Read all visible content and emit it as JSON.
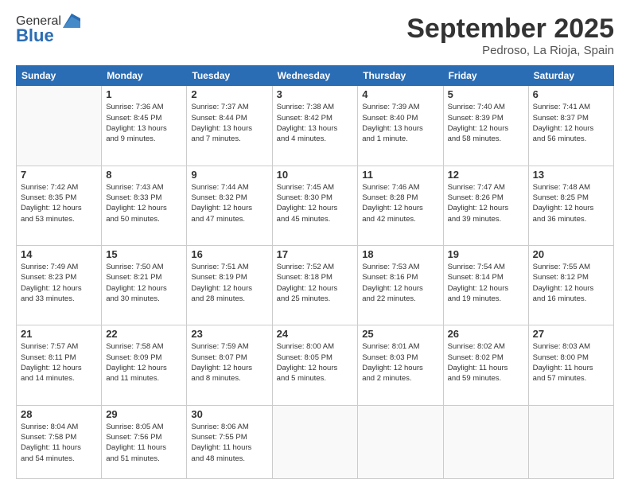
{
  "header": {
    "logo_line1": "General",
    "logo_line2": "Blue",
    "month": "September 2025",
    "location": "Pedroso, La Rioja, Spain"
  },
  "weekdays": [
    "Sunday",
    "Monday",
    "Tuesday",
    "Wednesday",
    "Thursday",
    "Friday",
    "Saturday"
  ],
  "weeks": [
    [
      {
        "day": "",
        "info": ""
      },
      {
        "day": "1",
        "info": "Sunrise: 7:36 AM\nSunset: 8:45 PM\nDaylight: 13 hours\nand 9 minutes."
      },
      {
        "day": "2",
        "info": "Sunrise: 7:37 AM\nSunset: 8:44 PM\nDaylight: 13 hours\nand 7 minutes."
      },
      {
        "day": "3",
        "info": "Sunrise: 7:38 AM\nSunset: 8:42 PM\nDaylight: 13 hours\nand 4 minutes."
      },
      {
        "day": "4",
        "info": "Sunrise: 7:39 AM\nSunset: 8:40 PM\nDaylight: 13 hours\nand 1 minute."
      },
      {
        "day": "5",
        "info": "Sunrise: 7:40 AM\nSunset: 8:39 PM\nDaylight: 12 hours\nand 58 minutes."
      },
      {
        "day": "6",
        "info": "Sunrise: 7:41 AM\nSunset: 8:37 PM\nDaylight: 12 hours\nand 56 minutes."
      }
    ],
    [
      {
        "day": "7",
        "info": "Sunrise: 7:42 AM\nSunset: 8:35 PM\nDaylight: 12 hours\nand 53 minutes."
      },
      {
        "day": "8",
        "info": "Sunrise: 7:43 AM\nSunset: 8:33 PM\nDaylight: 12 hours\nand 50 minutes."
      },
      {
        "day": "9",
        "info": "Sunrise: 7:44 AM\nSunset: 8:32 PM\nDaylight: 12 hours\nand 47 minutes."
      },
      {
        "day": "10",
        "info": "Sunrise: 7:45 AM\nSunset: 8:30 PM\nDaylight: 12 hours\nand 45 minutes."
      },
      {
        "day": "11",
        "info": "Sunrise: 7:46 AM\nSunset: 8:28 PM\nDaylight: 12 hours\nand 42 minutes."
      },
      {
        "day": "12",
        "info": "Sunrise: 7:47 AM\nSunset: 8:26 PM\nDaylight: 12 hours\nand 39 minutes."
      },
      {
        "day": "13",
        "info": "Sunrise: 7:48 AM\nSunset: 8:25 PM\nDaylight: 12 hours\nand 36 minutes."
      }
    ],
    [
      {
        "day": "14",
        "info": "Sunrise: 7:49 AM\nSunset: 8:23 PM\nDaylight: 12 hours\nand 33 minutes."
      },
      {
        "day": "15",
        "info": "Sunrise: 7:50 AM\nSunset: 8:21 PM\nDaylight: 12 hours\nand 30 minutes."
      },
      {
        "day": "16",
        "info": "Sunrise: 7:51 AM\nSunset: 8:19 PM\nDaylight: 12 hours\nand 28 minutes."
      },
      {
        "day": "17",
        "info": "Sunrise: 7:52 AM\nSunset: 8:18 PM\nDaylight: 12 hours\nand 25 minutes."
      },
      {
        "day": "18",
        "info": "Sunrise: 7:53 AM\nSunset: 8:16 PM\nDaylight: 12 hours\nand 22 minutes."
      },
      {
        "day": "19",
        "info": "Sunrise: 7:54 AM\nSunset: 8:14 PM\nDaylight: 12 hours\nand 19 minutes."
      },
      {
        "day": "20",
        "info": "Sunrise: 7:55 AM\nSunset: 8:12 PM\nDaylight: 12 hours\nand 16 minutes."
      }
    ],
    [
      {
        "day": "21",
        "info": "Sunrise: 7:57 AM\nSunset: 8:11 PM\nDaylight: 12 hours\nand 14 minutes."
      },
      {
        "day": "22",
        "info": "Sunrise: 7:58 AM\nSunset: 8:09 PM\nDaylight: 12 hours\nand 11 minutes."
      },
      {
        "day": "23",
        "info": "Sunrise: 7:59 AM\nSunset: 8:07 PM\nDaylight: 12 hours\nand 8 minutes."
      },
      {
        "day": "24",
        "info": "Sunrise: 8:00 AM\nSunset: 8:05 PM\nDaylight: 12 hours\nand 5 minutes."
      },
      {
        "day": "25",
        "info": "Sunrise: 8:01 AM\nSunset: 8:03 PM\nDaylight: 12 hours\nand 2 minutes."
      },
      {
        "day": "26",
        "info": "Sunrise: 8:02 AM\nSunset: 8:02 PM\nDaylight: 11 hours\nand 59 minutes."
      },
      {
        "day": "27",
        "info": "Sunrise: 8:03 AM\nSunset: 8:00 PM\nDaylight: 11 hours\nand 57 minutes."
      }
    ],
    [
      {
        "day": "28",
        "info": "Sunrise: 8:04 AM\nSunset: 7:58 PM\nDaylight: 11 hours\nand 54 minutes."
      },
      {
        "day": "29",
        "info": "Sunrise: 8:05 AM\nSunset: 7:56 PM\nDaylight: 11 hours\nand 51 minutes."
      },
      {
        "day": "30",
        "info": "Sunrise: 8:06 AM\nSunset: 7:55 PM\nDaylight: 11 hours\nand 48 minutes."
      },
      {
        "day": "",
        "info": ""
      },
      {
        "day": "",
        "info": ""
      },
      {
        "day": "",
        "info": ""
      },
      {
        "day": "",
        "info": ""
      }
    ]
  ]
}
